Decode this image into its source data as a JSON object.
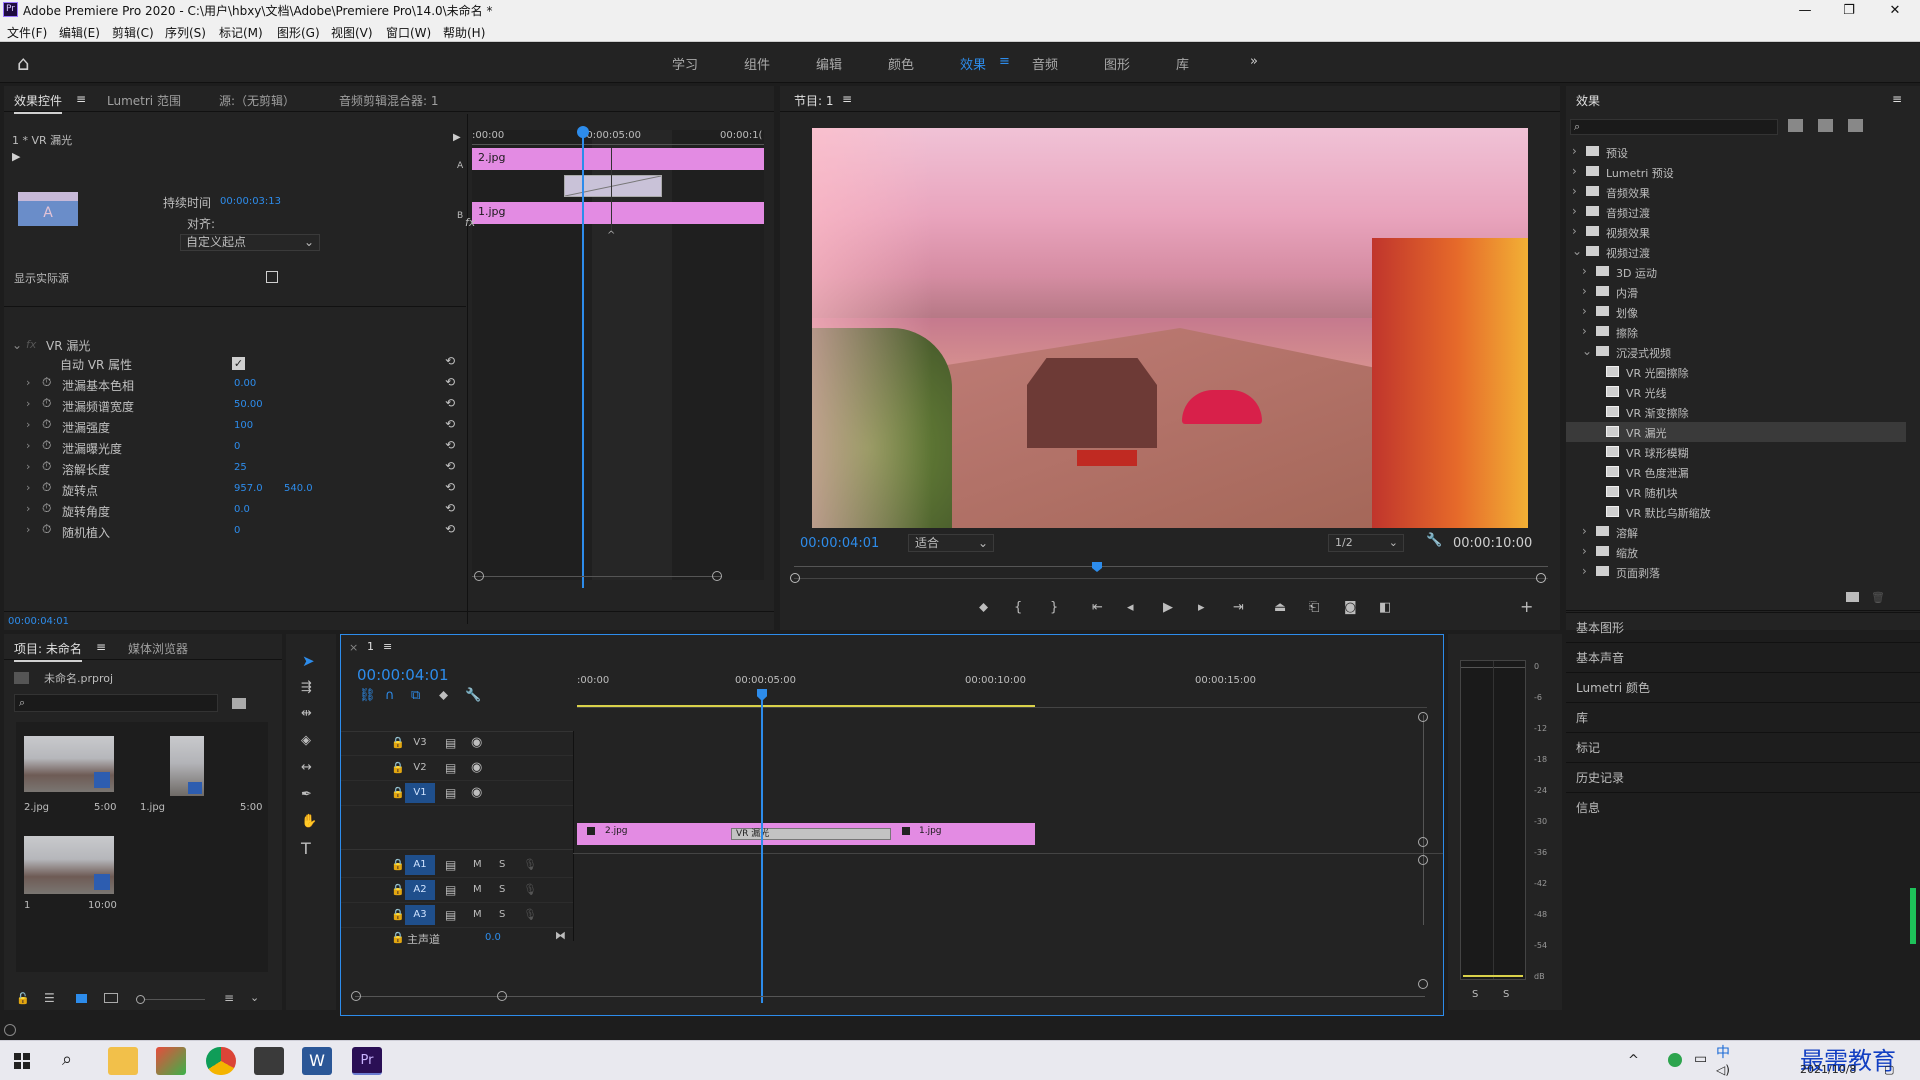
{
  "window": {
    "title": "Adobe Premiere Pro 2020 - C:\\用户\\hbxy\\文档\\Adobe\\Premiere Pro\\14.0\\未命名 *",
    "logo": "Pr",
    "min": "—",
    "max": "❐",
    "close": "✕"
  },
  "menu": [
    "文件(F)",
    "编辑(E)",
    "剪辑(C)",
    "序列(S)",
    "标记(M)",
    "图形(G)",
    "视图(V)",
    "窗口(W)",
    "帮助(H)"
  ],
  "workspaces": [
    "学习",
    "组件",
    "编辑",
    "颜色",
    "效果",
    "音频",
    "图形",
    "库"
  ],
  "workspace_active": "效果",
  "workspace_more": "»",
  "home_icon": "⌂",
  "effect_controls": {
    "tabs": [
      "效果控件",
      "Lumetri 范围",
      "源:（无剪辑）",
      "音频剪辑混合器: 1"
    ],
    "clip_title": "1 * VR 漏光",
    "ruler": [
      ":00:00",
      "00:00:05:00",
      "00:00:1("
    ],
    "clip_a": "2.jpg",
    "clip_b": "1.jpg",
    "label_a": "A",
    "label_b": "B",
    "fx": "fx",
    "duration_label": "持续时间",
    "duration": "00:00:03:13",
    "align_label": "对齐:",
    "align_value": "自定义起点",
    "show_source": "显示实际源",
    "effect_name": "VR 漏光",
    "params": [
      {
        "name": "自动 VR 属性",
        "value": ""
      },
      {
        "name": "泄漏基本色相",
        "value": "0.00"
      },
      {
        "name": "泄漏频谱宽度",
        "value": "50.00"
      },
      {
        "name": "泄漏强度",
        "value": "100"
      },
      {
        "name": "泄漏曝光度",
        "value": "0"
      },
      {
        "name": "溶解长度",
        "value": "25"
      },
      {
        "name": "旋转点",
        "value": "957.0",
        "value2": "540.0"
      },
      {
        "name": "旋转角度",
        "value": "0.0"
      },
      {
        "name": "随机植入",
        "value": "0"
      }
    ],
    "timecode": "00:00:04:01"
  },
  "program": {
    "title": "节目: 1",
    "timecode": "00:00:04:01",
    "fit": "适合",
    "quality": "1/2",
    "duration": "00:00:10:00"
  },
  "effects_panel": {
    "title": "效果",
    "tree": [
      {
        "label": "预设",
        "level": 0,
        "type": "folder",
        "arrow": "›"
      },
      {
        "label": "Lumetri 预设",
        "level": 0,
        "type": "folder",
        "arrow": "›"
      },
      {
        "label": "音频效果",
        "level": 0,
        "type": "folder",
        "arrow": "›"
      },
      {
        "label": "音频过渡",
        "level": 0,
        "type": "folder",
        "arrow": "›"
      },
      {
        "label": "视频效果",
        "level": 0,
        "type": "folder",
        "arrow": "›"
      },
      {
        "label": "视频过渡",
        "level": 0,
        "type": "folder",
        "arrow": "⌄"
      },
      {
        "label": "3D 运动",
        "level": 1,
        "type": "folder",
        "arrow": "›"
      },
      {
        "label": "内滑",
        "level": 1,
        "type": "folder",
        "arrow": "›"
      },
      {
        "label": "划像",
        "level": 1,
        "type": "folder",
        "arrow": "›"
      },
      {
        "label": "擦除",
        "level": 1,
        "type": "folder",
        "arrow": "›"
      },
      {
        "label": "沉浸式视频",
        "level": 1,
        "type": "folder",
        "arrow": "⌄"
      },
      {
        "label": "VR 光圈擦除",
        "level": 2,
        "type": "item",
        "arrow": ""
      },
      {
        "label": "VR 光线",
        "level": 2,
        "type": "item",
        "arrow": ""
      },
      {
        "label": "VR 渐变擦除",
        "level": 2,
        "type": "item",
        "arrow": ""
      },
      {
        "label": "VR 漏光",
        "level": 2,
        "type": "item",
        "arrow": "",
        "selected": true
      },
      {
        "label": "VR 球形模糊",
        "level": 2,
        "type": "item",
        "arrow": ""
      },
      {
        "label": "VR 色度泄漏",
        "level": 2,
        "type": "item",
        "arrow": ""
      },
      {
        "label": "VR 随机块",
        "level": 2,
        "type": "item",
        "arrow": ""
      },
      {
        "label": "VR 默比乌斯缩放",
        "level": 2,
        "type": "item",
        "arrow": ""
      },
      {
        "label": "溶解",
        "level": 1,
        "type": "folder",
        "arrow": "›"
      },
      {
        "label": "缩放",
        "level": 1,
        "type": "folder",
        "arrow": "›"
      },
      {
        "label": "页面剥落",
        "level": 1,
        "type": "folder",
        "arrow": "›"
      }
    ],
    "sections": [
      "基本图形",
      "基本声音",
      "Lumetri 颜色",
      "库",
      "标记",
      "历史记录",
      "信息"
    ]
  },
  "project": {
    "tabs": [
      "项目: 未命名",
      "媒体浏览器"
    ],
    "file": "未命名.prproj",
    "items": [
      {
        "name": "2.jpg",
        "dur": "5:00"
      },
      {
        "name": "1.jpg",
        "dur": "5:00"
      },
      {
        "name": "1",
        "dur": "10:00"
      }
    ]
  },
  "timeline": {
    "tab": "1",
    "close": "×",
    "timecode": "00:00:04:01",
    "ruler": [
      ":00:00",
      "00:00:05:00",
      "00:00:10:00",
      "00:00:15:00"
    ],
    "tracks_video": [
      "V3",
      "V2",
      "V1"
    ],
    "tracks_audio": [
      "A1",
      "A2",
      "A3"
    ],
    "master": "主声道",
    "master_val": "0.0",
    "clip1": "2.jpg",
    "clip2": "1.jpg",
    "transition": "VR 漏光",
    "m": "M",
    "s": "S"
  },
  "meter": {
    "scale": [
      "0",
      "-6",
      "-12",
      "-18",
      "-24",
      "-30",
      "-36",
      "-42",
      "-48",
      "-54",
      "dB"
    ],
    "solo": "S"
  },
  "taskbar": {
    "time": "",
    "date": "2021/10/8",
    "watermark": "最需教育",
    "ime": "中"
  }
}
